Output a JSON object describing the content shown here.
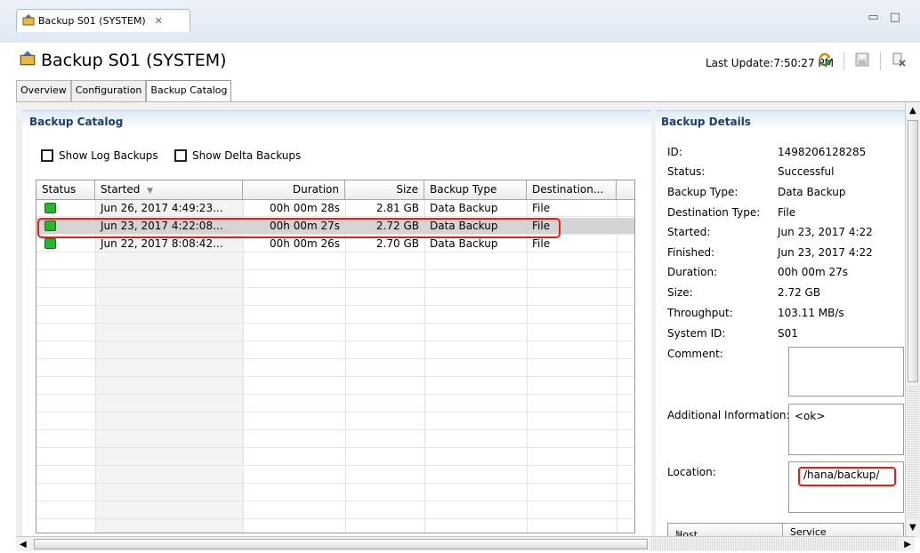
{
  "editor_tab": {
    "title": "Backup S01 (SYSTEM)",
    "close_glyph": "✕",
    "icon": "backup-editor-icon"
  },
  "window_controls": {
    "minimize": "▭",
    "maximize": "□"
  },
  "header": {
    "title": "Backup S01 (SYSTEM)",
    "last_update": "Last Update:7:50:27 PM",
    "icons": [
      "refresh-icon",
      "save-icon",
      "cancel-icon"
    ]
  },
  "tabs": [
    {
      "label": "Overview",
      "active": false
    },
    {
      "label": "Configuration",
      "active": false
    },
    {
      "label": "Backup Catalog",
      "active": true
    }
  ],
  "catalog": {
    "title": "Backup Catalog",
    "show_log_backups": "Show Log Backups",
    "show_delta_backups": "Show Delta Backups",
    "columns": [
      "Status",
      "Started",
      "Duration",
      "Size",
      "Backup Type",
      "Destination..."
    ],
    "sort_indicator": "▼",
    "rows": [
      {
        "status": "successful",
        "started": "Jun 26, 2017 4:49:23...",
        "duration": "00h 00m 28s",
        "size": "2.81 GB",
        "backup_type": "Data Backup",
        "destination": "File",
        "selected": false
      },
      {
        "status": "successful",
        "started": "Jun 23, 2017 4:22:08...",
        "duration": "00h 00m 27s",
        "size": "2.72 GB",
        "backup_type": "Data Backup",
        "destination": "File",
        "selected": true
      },
      {
        "status": "successful",
        "started": "Jun 22, 2017 8:08:42...",
        "duration": "00h 00m 26s",
        "size": "2.70 GB",
        "backup_type": "Data Backup",
        "destination": "File",
        "selected": false
      }
    ],
    "status_color": "#29b52d",
    "highlight_color": "#e0201d"
  },
  "details": {
    "title": "Backup Details",
    "fields": [
      {
        "label": "ID:",
        "value": "1498206128285"
      },
      {
        "label": "Status:",
        "value": "Successful"
      },
      {
        "label": "Backup Type:",
        "value": "Data Backup"
      },
      {
        "label": "Destination Type:",
        "value": "File"
      },
      {
        "label": "Started:",
        "value": "Jun 23, 2017 4:22"
      },
      {
        "label": "Finished:",
        "value": "Jun 23, 2017 4:22"
      },
      {
        "label": "Duration:",
        "value": "00h 00m 27s"
      },
      {
        "label": "Size:",
        "value": "2.72 GB"
      },
      {
        "label": "Throughput:",
        "value": "103.11 MB/s"
      },
      {
        "label": "System ID:",
        "value": "S01"
      }
    ],
    "comment_label": "Comment:",
    "comment_value": "",
    "additional_label": "Additional Information:",
    "additional_value": "<ok>",
    "location_label": "Location:",
    "location_value": "/hana/backup/",
    "table_columns": [
      "Host",
      "Service"
    ],
    "sort_indicator": "▲"
  }
}
